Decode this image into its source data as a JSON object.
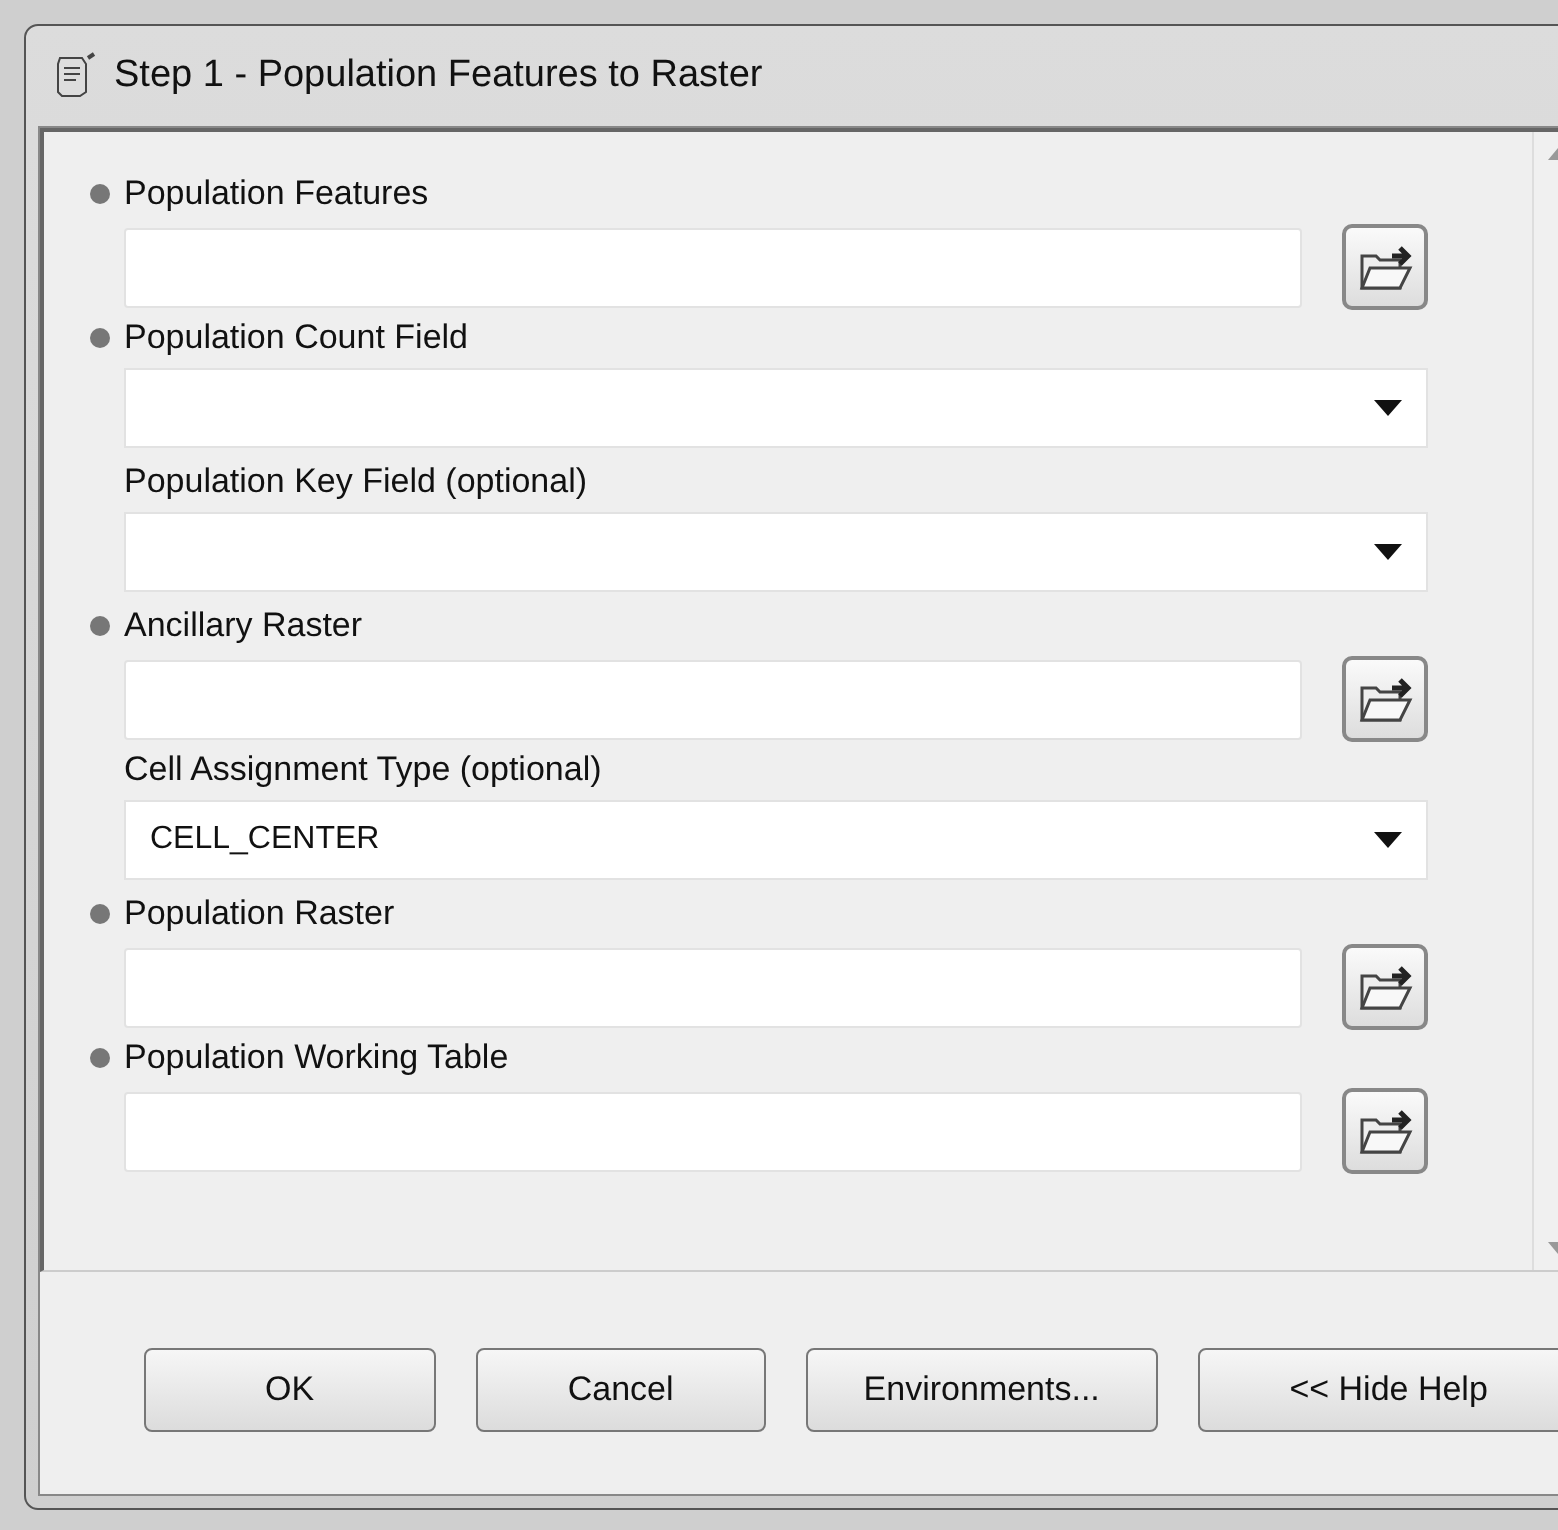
{
  "window": {
    "title": "Step 1 - Population Features to Raster"
  },
  "parameters": [
    {
      "label": "Population Features",
      "required": true,
      "kind": "browse"
    },
    {
      "label": "Population Count Field",
      "required": true,
      "kind": "dropdown"
    },
    {
      "label": "Population Key Field (optional)",
      "required": false,
      "kind": "dropdown"
    },
    {
      "label": "Ancillary Raster",
      "required": true,
      "kind": "browse"
    },
    {
      "label": "Cell Assignment Type (optional)",
      "required": false,
      "kind": "dropdown",
      "value": "CELL_CENTER"
    },
    {
      "label": "Population Raster",
      "required": true,
      "kind": "browse"
    },
    {
      "label": "Population Working Table",
      "required": true,
      "kind": "browse"
    }
  ],
  "buttons": [
    "OK",
    "Cancel",
    "Environments...",
    "<< Hide Help"
  ]
}
